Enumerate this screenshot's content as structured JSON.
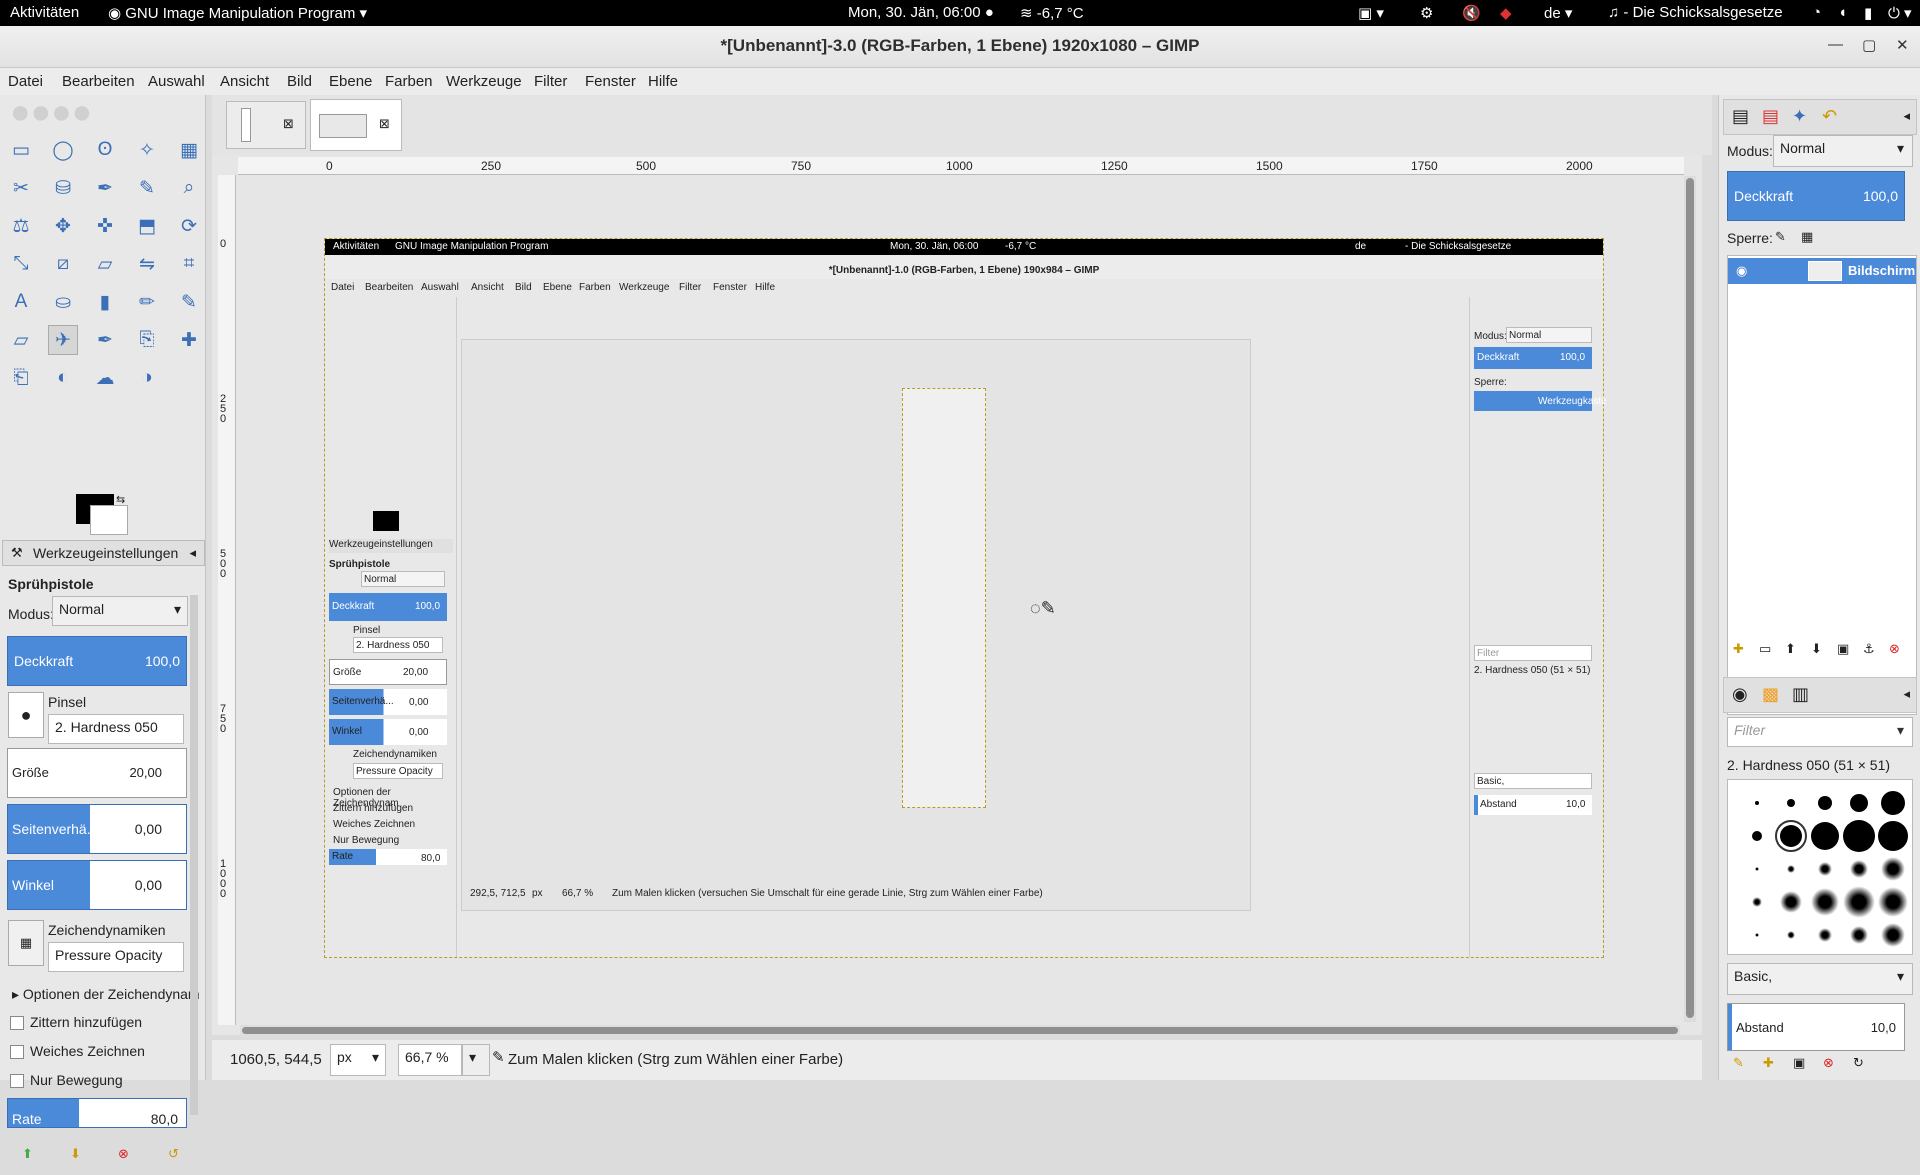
{
  "topbar": {
    "activities": "Aktivitäten",
    "app": "GNU Image Manipulation Program",
    "clock": "Mon, 30. Jän, 06:00",
    "weather": "-6,7 °C",
    "lang": "de",
    "music": "- Die Schicksalsgesetze"
  },
  "window": {
    "title": "*[Unbenannt]-3.0 (RGB-Farben, 1 Ebene) 1920x1080 – GIMP"
  },
  "menu": [
    "Datei",
    "Bearbeiten",
    "Auswahl",
    "Ansicht",
    "Bild",
    "Ebene",
    "Farben",
    "Werkzeuge",
    "Filter",
    "Fenster",
    "Hilfe"
  ],
  "tooloptions": {
    "header": "Werkzeugeinstellungen",
    "tool": "Sprühpistole",
    "mode_label": "Modus:",
    "mode_value": "Normal",
    "opacity_label": "Deckkraft",
    "opacity_value": "100,0",
    "brush_label": "Pinsel",
    "brush_value": "2. Hardness 050",
    "size_label": "Größe",
    "size_value": "20,00",
    "aspect_label": "Seitenverhä...",
    "aspect_value": "0,00",
    "angle_label": "Winkel",
    "angle_value": "0,00",
    "dynamics_label": "Zeichendynamiken",
    "dynamics_value": "Pressure Opacity",
    "dynopts": "Optionen der Zeichendynam",
    "jitter": "Zittern hinzufügen",
    "smooth": "Weiches Zeichnen",
    "motion": "Nur Bewegung",
    "rate_label": "Rate",
    "rate_value": "80,0"
  },
  "ruler": {
    "h": [
      "0",
      "250",
      "500",
      "750",
      "1000",
      "1250",
      "1500",
      "1750",
      "2000"
    ],
    "v": [
      "0",
      "250",
      "500",
      "750",
      "1000"
    ]
  },
  "status": {
    "coords": "1060,5, 544,5",
    "unit": "px",
    "zoom": "66,7 %",
    "hint": "Zum Malen klicken (Strg zum Wählen einer Farbe)"
  },
  "layers": {
    "mode_label": "Modus:",
    "mode_value": "Normal",
    "opacity_label": "Deckkraft",
    "opacity_value": "100,0",
    "lock_label": "Sperre:",
    "layer_name": "Bildschirm"
  },
  "brushes": {
    "filter_placeholder": "Filter",
    "current": "2. Hardness 050 (51 × 51)",
    "set": "Basic,",
    "spacing_label": "Abstand",
    "spacing_value": "10,0"
  },
  "inner": {
    "activities": "Aktivitäten",
    "app": "GNU Image Manipulation Program",
    "clock": "Mon, 30. Jän, 06:00",
    "weather": "-6,7 °C",
    "lang": "de",
    "music": "- Die Schicksalsgesetze",
    "title": "*[Unbenannt]-1.0 (RGB-Farben, 1 Ebene) 190x984 – GIMP",
    "coords": "292,5, 712,5",
    "unit": "px",
    "zoom": "66,7 %",
    "hint": "Zum Malen klicken (versuchen Sie Umschalt für eine gerade Linie, Strg zum Wählen einer Farbe)",
    "layer": "Werkzeugkaste",
    "tooloptions": "Werkzeugeinstellungen",
    "tool": "Sprühpistole",
    "mode": "Normal",
    "opacity": "Deckkraft",
    "opacity_value": "100,0",
    "brush": "Pinsel",
    "brush_value": "2. Hardness 050",
    "size": "Größe",
    "size_value": "20,00",
    "aspect": "Seitenverhä...",
    "aspect_value": "0,00",
    "angle": "Winkel",
    "angle_value": "0,00",
    "dynamics": "Zeichendynamiken",
    "dynamics_value": "Pressure Opacity",
    "dynopts": "Optionen der Zeichendynam",
    "jitter": "Zittern hinzufügen",
    "smooth": "Weiches Zeichnen",
    "motion": "Nur Bewegung",
    "rate": "Rate",
    "rate_value": "80,0",
    "brushinfo": "2. Hardness 050 (51 × 51)",
    "filter": "Filter",
    "set": "Basic,",
    "spacing": "Abstand",
    "spacing_value": "10,0",
    "mode_label": "Modus:",
    "mode_value": "Normal",
    "lock": "Sperre:",
    "menu": [
      "Datei",
      "Bearbeiten",
      "Auswahl",
      "Ansicht",
      "Bild",
      "Ebene",
      "Farben",
      "Werkzeuge",
      "Filter",
      "Fenster",
      "Hilfe"
    ]
  }
}
